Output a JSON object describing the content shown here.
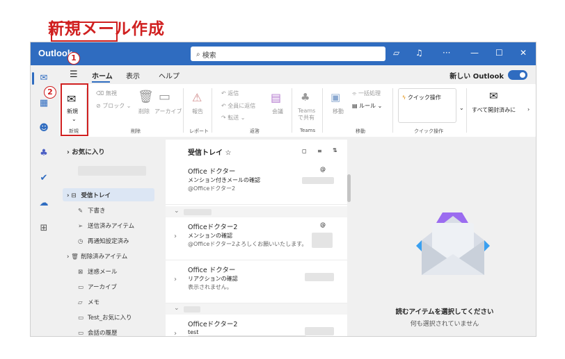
{
  "heading": "新規メール作成",
  "badges": {
    "one": "1",
    "two": "2"
  },
  "titlebar": {
    "app": "Outlook",
    "search_placeholder": "検索"
  },
  "tabs": {
    "home": "ホーム",
    "view": "表示",
    "help": "ヘルプ",
    "new_outlook": "新しい Outlook"
  },
  "ribbon": {
    "new_label": "新規",
    "ignore": "無視",
    "block": "ブロック",
    "delete": "削除",
    "archive": "アーカイブ",
    "report": "報告",
    "reply": "返信",
    "reply_all": "全員に返信",
    "forward": "転送",
    "meeting": "会議",
    "teams_share": "Teams で共有",
    "move": "移動",
    "bulk": "一括処理",
    "rules": "ルール",
    "quick_steps": "クイック操作",
    "mark_all_read": "すべて開封済みに",
    "group_new": "新規",
    "group_delete": "削除",
    "group_report": "レポート",
    "group_respond": "返答",
    "group_teams": "Teams",
    "group_move": "移動",
    "group_quick": "クイック操作"
  },
  "folders": {
    "favorites": "お気に入り",
    "inbox": "受信トレイ",
    "drafts": "下書き",
    "sent": "送信済みアイテム",
    "scheduled": "再通知設定済み",
    "deleted": "削除済みアイテム",
    "junk": "迷惑メール",
    "archive": "アーカイブ",
    "notes": "メモ",
    "test_fav": "Test_お気に入り",
    "conversation": "会話の履歴"
  },
  "list": {
    "title": "受信トレイ",
    "messages": [
      {
        "from": "Office ドクター",
        "subject": "メンション付きメールの確認",
        "preview": "@Officeドクター2",
        "mention": "@"
      },
      {
        "from": "Officeドクター2",
        "subject": "メンションの確認",
        "preview": "@Officeドクター2よろしくお願いいたします。",
        "mention": "@"
      },
      {
        "from": "Office ドクター",
        "subject": "リアクションの確認",
        "preview": "表示されません。"
      },
      {
        "from": "Officeドクター2",
        "subject": "test",
        "preview": ""
      }
    ]
  },
  "reading": {
    "title": "読むアイテムを選択してください",
    "subtitle": "何も選択されていません"
  },
  "colors": {
    "brand": "#2f6cc0",
    "annotation": "#d02020"
  }
}
